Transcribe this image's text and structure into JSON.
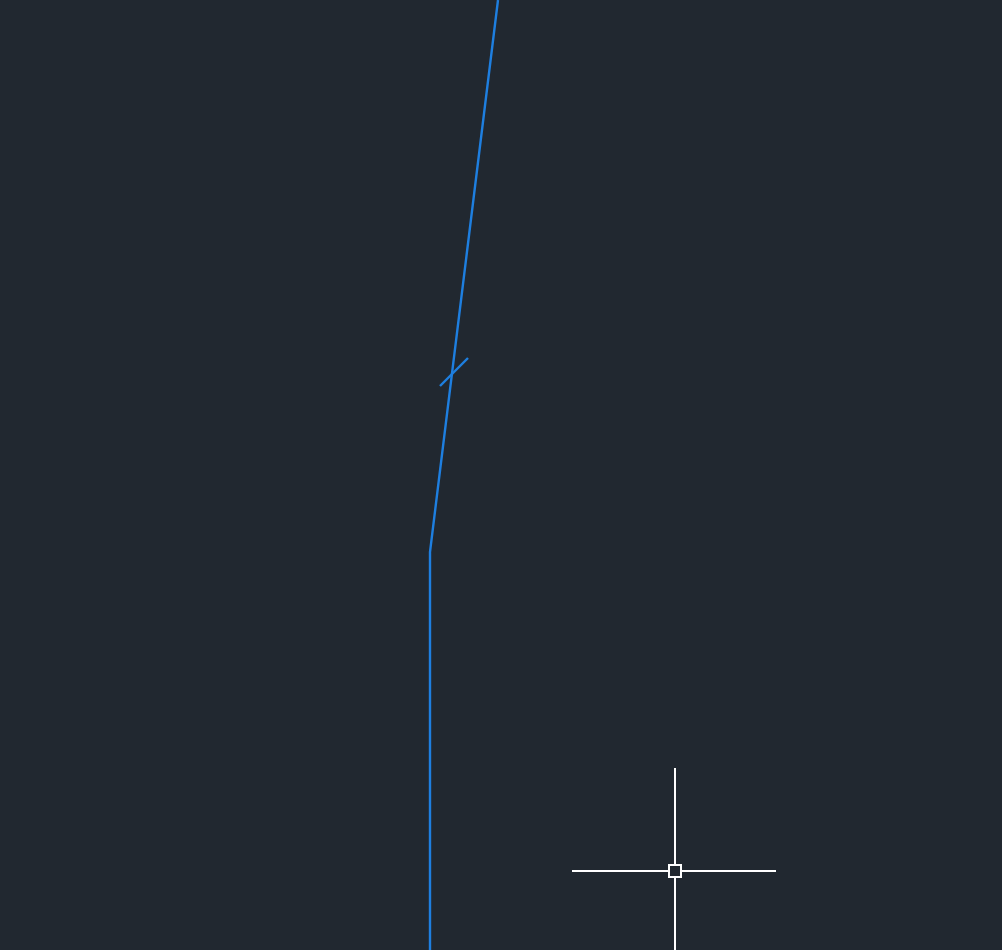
{
  "drawing_area": {
    "kind": "model_space"
  },
  "cursor": {
    "kind": "crosshair"
  }
}
